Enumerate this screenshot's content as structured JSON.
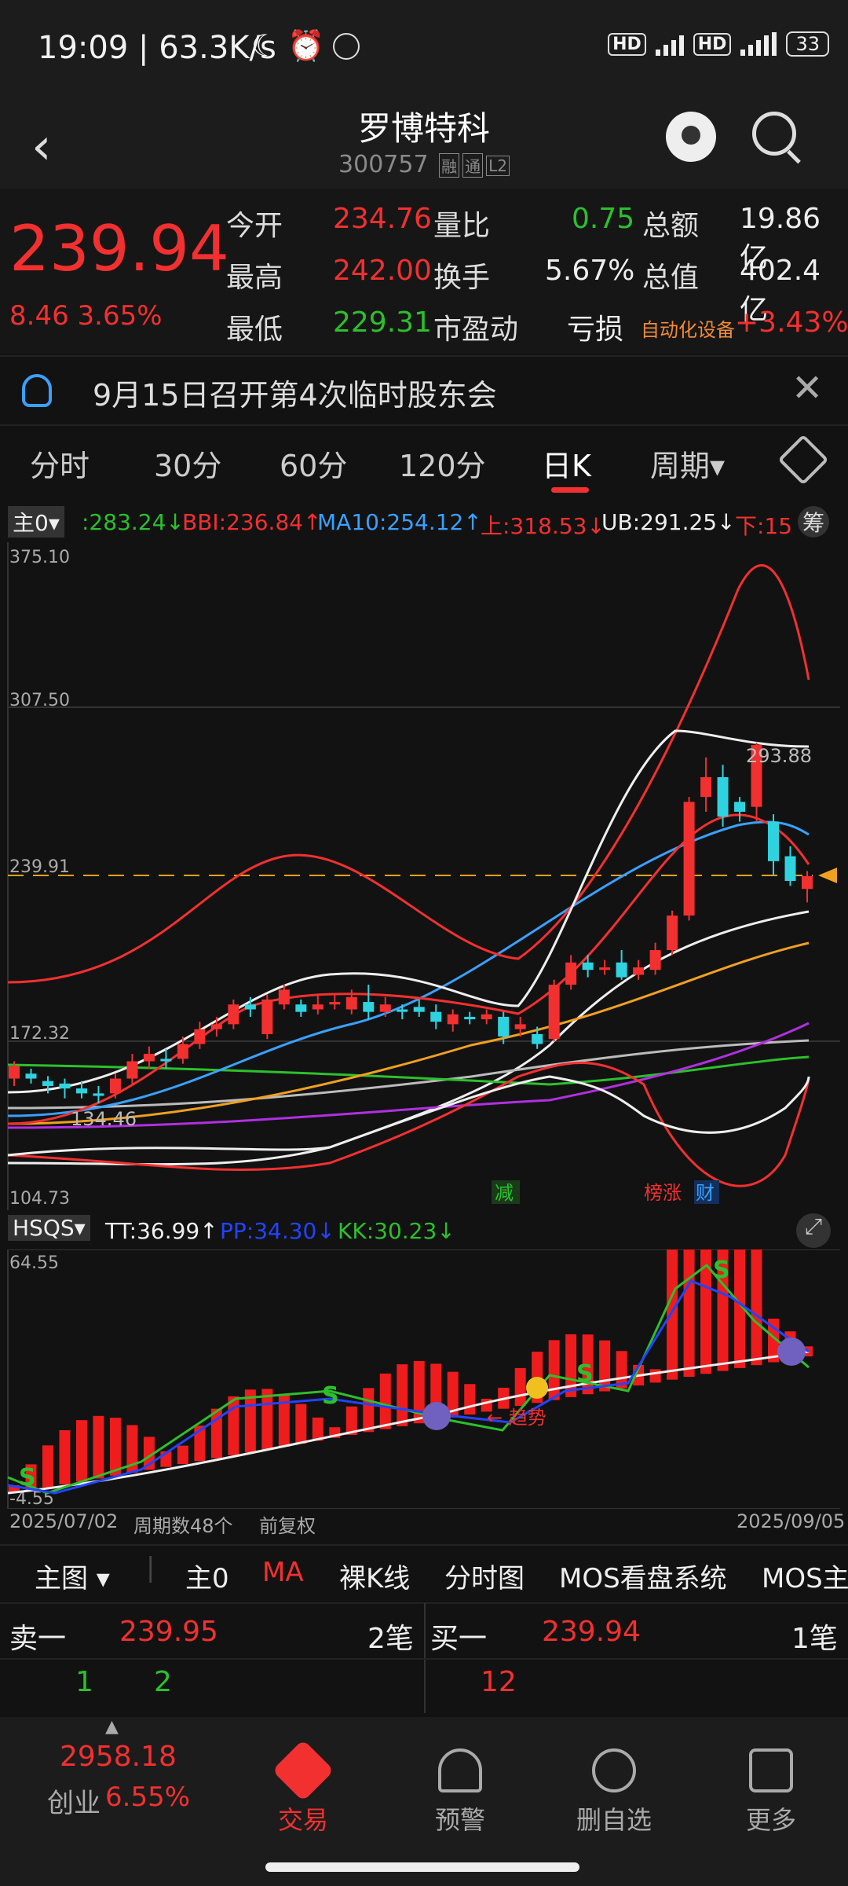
{
  "status_bar": {
    "time": "19:09",
    "speed": "63.3K/s",
    "battery": "33"
  },
  "header": {
    "title": "罗博特科",
    "code": "300757",
    "tags": [
      "融",
      "通",
      "L2"
    ]
  },
  "quote": {
    "price": "239.94",
    "change": "8.46",
    "change_pct": "3.65%",
    "rows": [
      [
        {
          "label": "今开",
          "value": "234.76"
        },
        {
          "label": "量比",
          "value": "0.75"
        },
        {
          "label": "总额",
          "value": "19.86亿"
        }
      ],
      [
        {
          "label": "最高",
          "value": "242.00"
        },
        {
          "label": "换手",
          "value": "5.67%"
        },
        {
          "label": "总值",
          "value": "402.4亿"
        }
      ],
      [
        {
          "label": "最低",
          "value": "229.31"
        },
        {
          "label": "市盈动",
          "value": "亏损"
        },
        {
          "label": "自动化设备",
          "value": "+3.43%"
        }
      ]
    ]
  },
  "notice": {
    "text": "9月15日召开第4次临时股东会"
  },
  "tabs": [
    "分时",
    "30分",
    "60分",
    "120分",
    "日K",
    "周期"
  ],
  "legend": {
    "main": "主0",
    "items": [
      ":283.24↓",
      "BBI:236.84↑",
      "MA10:254.12↑",
      "上:318.53↓",
      "UB:291.25↓",
      "下:15"
    ],
    "chips_label": "筹"
  },
  "main_axis": [
    "375.10",
    "307.50",
    "239.91",
    "172.32",
    "104.73"
  ],
  "main_annotations": {
    "high": "293.88",
    "low": "134.46",
    "tag_reduce": "减",
    "tag_list": "榜涨",
    "tag_fin": "财"
  },
  "indicator": {
    "name": "HSQS",
    "items": [
      "TT:36.99↑",
      "PP:34.30↓",
      "KK:30.23↓"
    ],
    "axis": [
      "64.55",
      "-4.55"
    ],
    "annotation": "← 趋势"
  },
  "dates": {
    "start": "2025/07/02",
    "period": "周期数48个",
    "adj": "前复权",
    "end": "2025/09/05"
  },
  "subtabs": [
    "主图",
    "主0",
    "MA",
    "裸K线",
    "分时图",
    "MOS看盘系统",
    "MOS主"
  ],
  "order_book": {
    "sell": {
      "label": "卖一",
      "price": "239.95",
      "count": "2笔",
      "q1": "1",
      "q2": "2"
    },
    "buy": {
      "label": "买一",
      "price": "239.94",
      "count": "1笔",
      "q1": "12"
    }
  },
  "bottom_nav": {
    "index_value": "2958.18",
    "index_name": "创业",
    "index_pct": "6.55%",
    "items": [
      "交易",
      "预警",
      "删自选",
      "更多"
    ]
  },
  "chart_data": {
    "type": "candlestick",
    "ylim": [
      104.73,
      375.1
    ],
    "candles": [
      {
        "o": 158,
        "c": 163,
        "h": 165,
        "l": 155
      },
      {
        "o": 160,
        "c": 158,
        "h": 162,
        "l": 156
      },
      {
        "o": 157,
        "c": 155,
        "h": 159,
        "l": 152
      },
      {
        "o": 156,
        "c": 154,
        "h": 158,
        "l": 150
      },
      {
        "o": 154,
        "c": 152,
        "h": 157,
        "l": 150
      },
      {
        "o": 152,
        "c": 151,
        "h": 155,
        "l": 148
      },
      {
        "o": 152,
        "c": 158,
        "h": 160,
        "l": 150
      },
      {
        "o": 158,
        "c": 165,
        "h": 168,
        "l": 156
      },
      {
        "o": 165,
        "c": 168,
        "h": 171,
        "l": 162
      },
      {
        "o": 166,
        "c": 165,
        "h": 170,
        "l": 162
      },
      {
        "o": 166,
        "c": 172,
        "h": 175,
        "l": 164
      },
      {
        "o": 172,
        "c": 178,
        "h": 181,
        "l": 170
      },
      {
        "o": 178,
        "c": 180,
        "h": 183,
        "l": 175
      },
      {
        "o": 180,
        "c": 188,
        "h": 190,
        "l": 178
      },
      {
        "o": 188,
        "c": 186,
        "h": 191,
        "l": 183
      },
      {
        "o": 176,
        "c": 190,
        "h": 192,
        "l": 174
      },
      {
        "o": 188,
        "c": 194,
        "h": 196,
        "l": 186
      },
      {
        "o": 188,
        "c": 185,
        "h": 190,
        "l": 183
      },
      {
        "o": 186,
        "c": 188,
        "h": 192,
        "l": 184
      },
      {
        "o": 188,
        "c": 189,
        "h": 192,
        "l": 186
      },
      {
        "o": 186,
        "c": 191,
        "h": 194,
        "l": 184
      },
      {
        "o": 189,
        "c": 185,
        "h": 196,
        "l": 182
      },
      {
        "o": 185,
        "c": 188,
        "h": 191,
        "l": 183
      },
      {
        "o": 186,
        "c": 185,
        "h": 188,
        "l": 182
      },
      {
        "o": 187,
        "c": 185,
        "h": 190,
        "l": 183
      },
      {
        "o": 185,
        "c": 181,
        "h": 188,
        "l": 178
      },
      {
        "o": 180,
        "c": 184,
        "h": 186,
        "l": 177
      },
      {
        "o": 183,
        "c": 182,
        "h": 185,
        "l": 180
      },
      {
        "o": 182,
        "c": 184,
        "h": 186,
        "l": 180
      },
      {
        "o": 183,
        "c": 175,
        "h": 185,
        "l": 172
      },
      {
        "o": 178,
        "c": 180,
        "h": 183,
        "l": 175
      },
      {
        "o": 176,
        "c": 172,
        "h": 179,
        "l": 170
      },
      {
        "o": 174,
        "c": 196,
        "h": 198,
        "l": 173
      },
      {
        "o": 196,
        "c": 205,
        "h": 208,
        "l": 194
      },
      {
        "o": 205,
        "c": 202,
        "h": 208,
        "l": 199
      },
      {
        "o": 202,
        "c": 203,
        "h": 206,
        "l": 200
      },
      {
        "o": 205,
        "c": 199,
        "h": 210,
        "l": 198
      },
      {
        "o": 200,
        "c": 203,
        "h": 206,
        "l": 198
      },
      {
        "o": 202,
        "c": 210,
        "h": 213,
        "l": 200
      },
      {
        "o": 210,
        "c": 224,
        "h": 226,
        "l": 208
      },
      {
        "o": 224,
        "c": 270,
        "h": 272,
        "l": 222
      },
      {
        "o": 272,
        "c": 280,
        "h": 288,
        "l": 266
      },
      {
        "o": 280,
        "c": 264,
        "h": 285,
        "l": 260
      },
      {
        "o": 270,
        "c": 266,
        "h": 272,
        "l": 262
      },
      {
        "o": 268,
        "c": 293,
        "h": 294,
        "l": 262
      },
      {
        "o": 262,
        "c": 246,
        "h": 265,
        "l": 240
      },
      {
        "o": 248,
        "c": 238,
        "h": 252,
        "l": 236
      },
      {
        "o": 234.76,
        "c": 239.94,
        "h": 242.0,
        "l": 229.31
      }
    ]
  }
}
